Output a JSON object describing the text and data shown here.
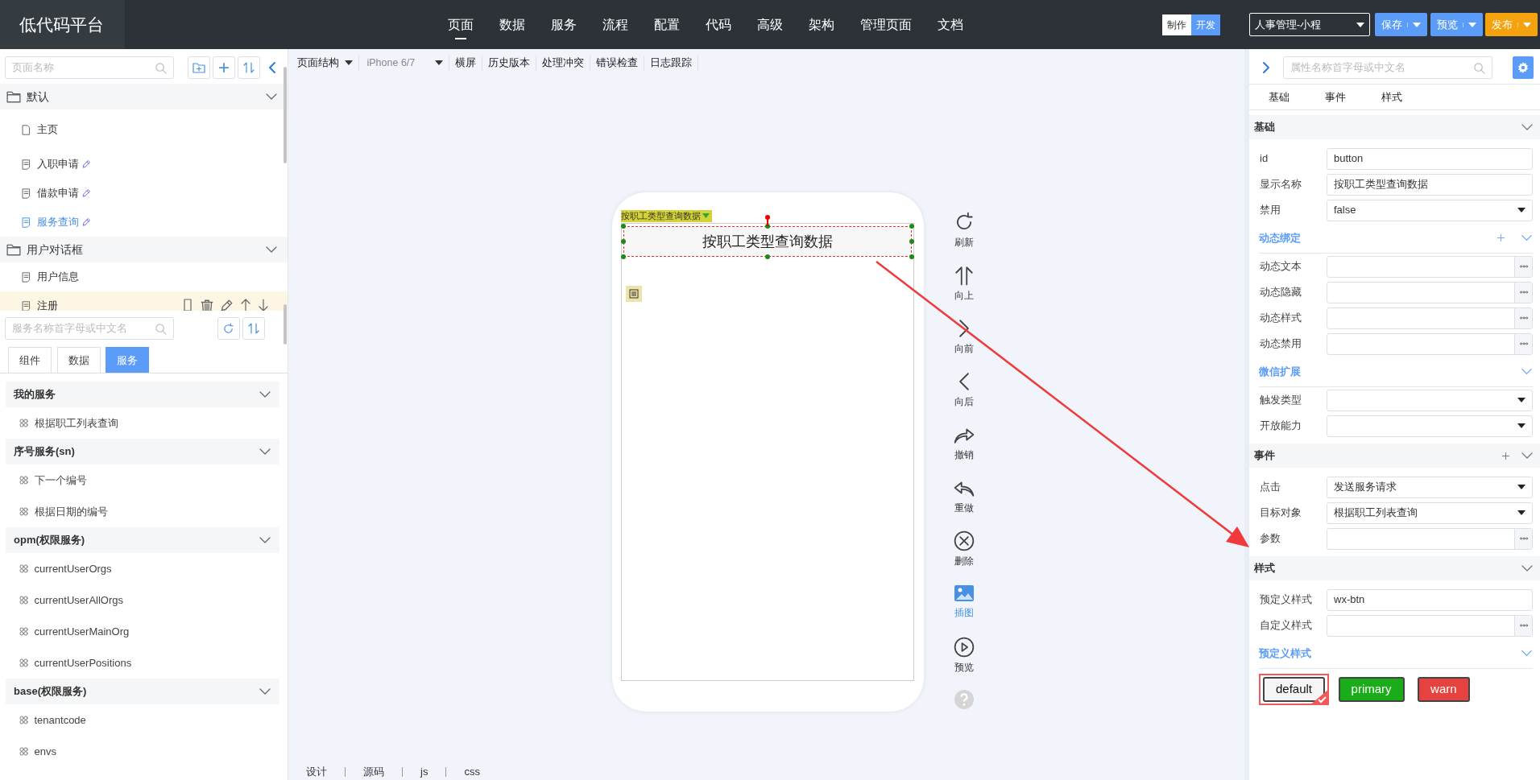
{
  "app": {
    "logo": "低代码平台"
  },
  "nav": [
    {
      "label": "页面",
      "selected": true
    },
    {
      "label": "数据",
      "selected": false
    },
    {
      "label": "服务",
      "selected": false
    },
    {
      "label": "流程",
      "selected": false
    },
    {
      "label": "配置",
      "selected": false
    },
    {
      "label": "代码",
      "selected": false
    },
    {
      "label": "高级",
      "selected": false
    },
    {
      "label": "架构",
      "selected": false
    },
    {
      "label": "管理页面",
      "selected": false
    },
    {
      "label": "文档",
      "selected": false
    }
  ],
  "mode_toggle": [
    {
      "label": "制作",
      "selected": true
    },
    {
      "label": "开发",
      "selected": false
    }
  ],
  "project_select": {
    "value": "人事管理-小程"
  },
  "actions": [
    {
      "label": "保存",
      "color": "#5b9cf8"
    },
    {
      "label": "预览",
      "color": "#5b9cf8"
    },
    {
      "label": "发布",
      "color": "#f5a20f"
    }
  ],
  "page_tree": {
    "search": {
      "placeholder": "页面名称"
    },
    "groups": [
      {
        "label": "默认",
        "expanded": true,
        "children": [
          {
            "label": "主页",
            "kind": "home",
            "selected": false,
            "editable": false,
            "hovered": false
          },
          {
            "label": "入职申请",
            "kind": "page",
            "selected": false,
            "editable": true,
            "hovered": false
          },
          {
            "label": "借款申请",
            "kind": "page",
            "selected": false,
            "editable": true,
            "hovered": false
          },
          {
            "label": "服务查询",
            "kind": "page",
            "selected": true,
            "editable": true,
            "hovered": false
          }
        ]
      },
      {
        "label": "用户对话框",
        "expanded": true,
        "children": [
          {
            "label": "用户信息",
            "kind": "page",
            "selected": false,
            "editable": false,
            "hovered": false
          },
          {
            "label": "注册",
            "kind": "page",
            "selected": false,
            "editable": false,
            "hovered": true
          }
        ]
      }
    ]
  },
  "service_panel": {
    "search": {
      "placeholder": "服务名称首字母或中文名"
    },
    "tabs": [
      {
        "label": "组件",
        "selected": false
      },
      {
        "label": "数据",
        "selected": false
      },
      {
        "label": "服务",
        "selected": true
      }
    ],
    "groups": [
      {
        "label": "我的服务",
        "expanded": true,
        "children": [
          {
            "label": "根据职工列表查询"
          }
        ]
      },
      {
        "label": "序号服务(sn)",
        "expanded": true,
        "children": [
          {
            "label": "下一个编号"
          },
          {
            "label": "根据日期的编号"
          }
        ]
      },
      {
        "label": "opm(权限服务)",
        "expanded": true,
        "children": [
          {
            "label": "currentUserOrgs"
          },
          {
            "label": "currentUserAllOrgs"
          },
          {
            "label": "currentUserMainOrg"
          },
          {
            "label": "currentUserPositions"
          }
        ]
      },
      {
        "label": "base(权限服务)",
        "expanded": true,
        "children": [
          {
            "label": "tenantcode"
          },
          {
            "label": "envs"
          }
        ]
      }
    ]
  },
  "canvas_toolbar": [
    {
      "label": "页面结构",
      "dropdown": true,
      "muted": false
    },
    {
      "label": "iPhone 6/7",
      "dropdown": true,
      "muted": true
    },
    {
      "label": "横屏",
      "dropdown": false,
      "muted": false
    },
    {
      "label": "历史版本",
      "dropdown": false,
      "muted": false
    },
    {
      "label": "处理冲突",
      "dropdown": false,
      "muted": false
    },
    {
      "label": "错误检查",
      "dropdown": false,
      "muted": false
    },
    {
      "label": "日志跟踪",
      "dropdown": false,
      "muted": false
    }
  ],
  "phone": {
    "component_tag": "按职工类型查询数据",
    "button": {
      "label": "按职工类型查询数据",
      "selected": true
    }
  },
  "tools": [
    {
      "label": "刷新",
      "kind": "refresh",
      "active": false
    },
    {
      "label": "向上",
      "kind": "up",
      "active": false
    },
    {
      "label": "向前",
      "kind": "next",
      "active": false
    },
    {
      "label": "向后",
      "kind": "prev",
      "active": false
    },
    {
      "label": "撤销",
      "kind": "redo",
      "active": false
    },
    {
      "label": "重做",
      "kind": "undo",
      "active": false
    },
    {
      "label": "删除",
      "kind": "delete",
      "active": false
    },
    {
      "label": "插图",
      "kind": "image",
      "active": true
    },
    {
      "label": "预览",
      "kind": "play",
      "active": false
    },
    {
      "kind": "help",
      "active": false
    }
  ],
  "bottom_tabs": [
    "设计",
    "源码",
    "js",
    "css"
  ],
  "props": {
    "search": {
      "placeholder": "属性名称首字母或中文名"
    },
    "tabs": [
      "基础",
      "事件",
      "样式"
    ],
    "sections": [
      {
        "title": "基础",
        "add": false,
        "rows": [
          {
            "kind": "field",
            "label": "id",
            "value": "button"
          },
          {
            "kind": "field",
            "label": "显示名称",
            "value": "按职工类型查询数据"
          },
          {
            "kind": "select",
            "label": "禁用",
            "value": "false"
          },
          {
            "kind": "subhead",
            "label": "动态绑定",
            "add": true
          },
          {
            "kind": "more",
            "label": "动态文本"
          },
          {
            "kind": "more",
            "label": "动态隐藏"
          },
          {
            "kind": "more",
            "label": "动态样式"
          },
          {
            "kind": "more",
            "label": "动态禁用"
          },
          {
            "kind": "subhead",
            "label": "微信扩展",
            "add": false
          },
          {
            "kind": "select",
            "label": "触发类型"
          },
          {
            "kind": "select",
            "label": "开放能力"
          }
        ]
      },
      {
        "title": "事件",
        "add": true,
        "rows": [
          {
            "kind": "select",
            "label": "点击",
            "value": "发送服务请求"
          },
          {
            "kind": "select",
            "label": "目标对象",
            "value": "根据职工列表查询"
          },
          {
            "kind": "more",
            "label": "参数"
          }
        ]
      },
      {
        "title": "样式",
        "add": false,
        "rows": [
          {
            "kind": "field",
            "label": "预定义样式",
            "value": "wx-btn"
          },
          {
            "kind": "more",
            "label": "自定义样式"
          },
          {
            "kind": "subhead",
            "label": "预定义样式",
            "add": false
          },
          {
            "kind": "swatches",
            "items": [
              {
                "label": "default",
                "color": "#f5f5f5",
                "selected": true
              },
              {
                "label": "primary",
                "color": "#1aad19",
                "selected": false
              },
              {
                "label": "warn",
                "color": "#e64340",
                "selected": false
              }
            ]
          }
        ]
      }
    ]
  }
}
